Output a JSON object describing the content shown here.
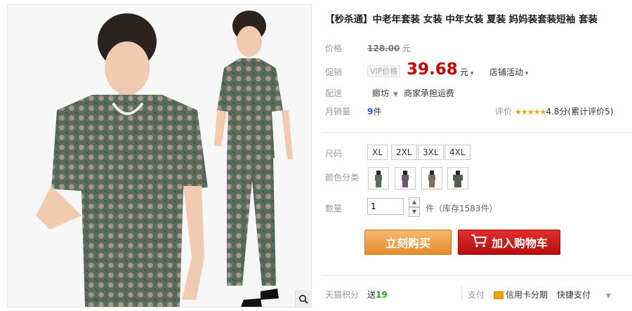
{
  "product": {
    "title": "【秒杀通】中老年套装 女装 中年女装 夏装 妈妈装套装短袖 套装"
  },
  "price": {
    "label": "价格",
    "original": "128.00",
    "currency": "元"
  },
  "promo": {
    "label": "促销",
    "vip_tag": "VIP价格",
    "price": "39.68",
    "unit": "元",
    "activity": "店铺活动"
  },
  "delivery": {
    "label": "配送",
    "location": "廊坊",
    "note": "商家承担运费"
  },
  "sales": {
    "label": "月销量",
    "count": "9",
    "unit": "件"
  },
  "rating": {
    "label": "评价",
    "stars": "★★★★★",
    "score": "4.8分(累计评价5)"
  },
  "size": {
    "label": "尺码",
    "options": [
      "XL",
      "2XL",
      "3XL",
      "4XL"
    ]
  },
  "color": {
    "label": "颜色分类"
  },
  "quantity": {
    "label": "数量",
    "value": "1",
    "stock_text": "件（库存1583件）"
  },
  "actions": {
    "buy_now": "立刻购买",
    "add_to_cart": "加入购物车"
  },
  "footer": {
    "points_label": "天猫积分",
    "points_text": "送",
    "points_value": "19",
    "pay_label": "支付",
    "card": "信用卡分期",
    "express": "快捷支付"
  },
  "colors": {
    "price_red": "#c40000",
    "buy_orange": "#e48d2e",
    "cart_red": "#c0100f",
    "link_blue": "#1f5bd1",
    "points_green": "#2b9b2b"
  }
}
